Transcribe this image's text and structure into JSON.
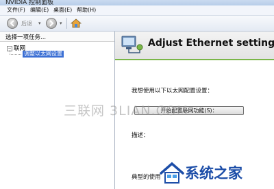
{
  "window": {
    "title": "NVIDIA 控制面板"
  },
  "menu": {
    "items": [
      "文件(F)",
      "编辑(E)",
      "桌面(E)",
      "帮助(H)"
    ]
  },
  "toolbar": {
    "back_label": "后退"
  },
  "left_pane": {
    "header": "选择一项任务...",
    "tree_root": "联网",
    "tree_child": "调整以太网设置"
  },
  "main": {
    "title": "Adjust Ethernet settings",
    "section_label": "我想使用以下以太网配置设置：",
    "configure_button": "开始配置联网功能(S)：",
    "description_label": "描述：",
    "typical_label": "典型的使用"
  },
  "watermark": {
    "text": "三联网 3LIAN.COM"
  },
  "logo": {
    "text": "系统之家"
  },
  "colors": {
    "selection": "#3b6fd4",
    "banner_accent": "#7ab648",
    "logo_blue": "#1d4ea8"
  }
}
